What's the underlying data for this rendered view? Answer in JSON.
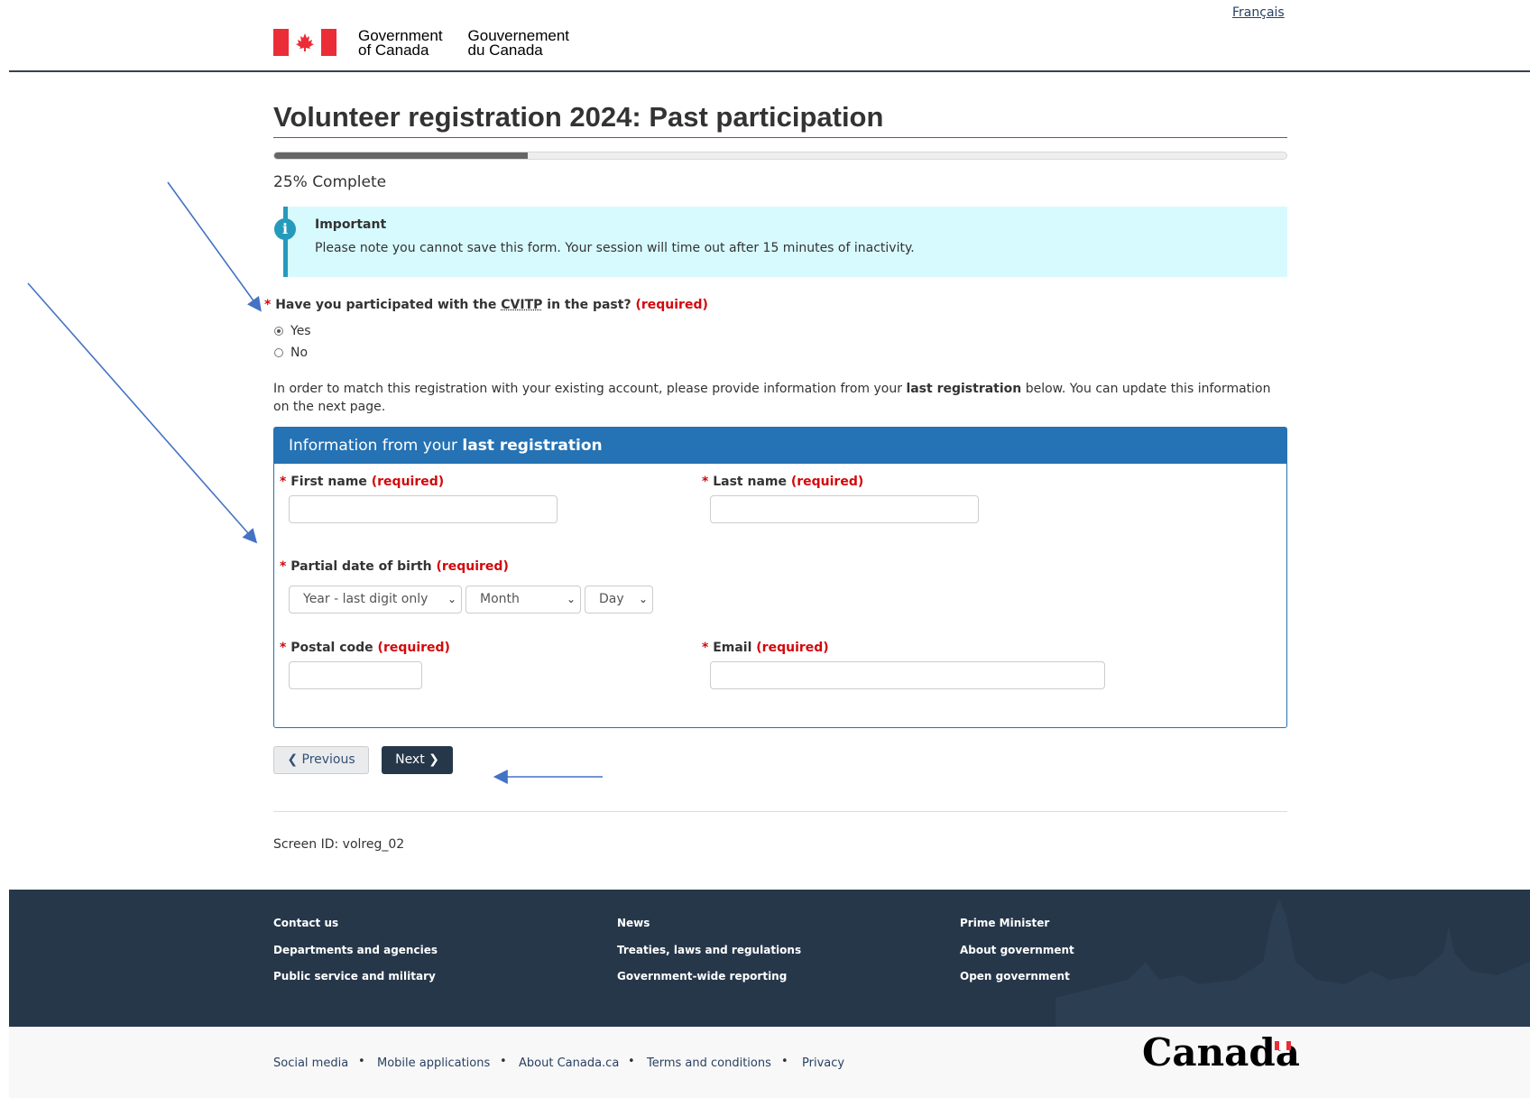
{
  "header": {
    "language_link": "Français",
    "signature_en_line1": "Government",
    "signature_en_line2": "of Canada",
    "signature_fr_line1": "Gouvernement",
    "signature_fr_line2": "du Canada"
  },
  "page": {
    "title": "Volunteer registration 2024: Past participation",
    "progress_percent": 25,
    "progress_label": "25% Complete"
  },
  "alert": {
    "title": "Important",
    "text": "Please note you cannot save this form. Your session will time out after 15 minutes of inactivity."
  },
  "question": {
    "star": "*",
    "text_before": "Have you participated with the ",
    "abbr": "CVITP",
    "text_after": " in the past?",
    "required": "(required)",
    "options": [
      {
        "label": "Yes",
        "checked": true
      },
      {
        "label": "No",
        "checked": false
      }
    ]
  },
  "info": {
    "text_before": "In order to match this registration with your existing account, please provide information from your ",
    "bold": "last registration",
    "text_after": " below. You can update this information on the next page."
  },
  "panel": {
    "heading_before": "Information from your ",
    "heading_bold": "last registration",
    "required_marker": "(required)",
    "star": "*",
    "first_name_label": "First name",
    "last_name_label": "Last name",
    "dob_label": "Partial date of birth",
    "postal_label": "Postal code",
    "email_label": "Email",
    "first_name_value": "",
    "last_name_value": "",
    "postal_value": "",
    "email_value": "",
    "year_select": "Year - last digit only",
    "month_select": "Month",
    "day_select": "Day"
  },
  "buttons": {
    "previous": "Previous",
    "next": "Next"
  },
  "screen_id": "Screen ID: volreg_02",
  "footer": {
    "col1": [
      "Contact us",
      "Departments and agencies",
      "Public service and military"
    ],
    "col2": [
      "News",
      "Treaties, laws and regulations",
      "Government-wide reporting"
    ],
    "col3": [
      "Prime Minister",
      "About government",
      "Open government"
    ],
    "sub_links": [
      "Social media",
      "Mobile applications",
      "About Canada.ca",
      "Terms and conditions",
      "Privacy"
    ],
    "separator": "•",
    "wordmark": "Canada"
  },
  "colors": {
    "flag_red": "#eb2d37",
    "required_red": "#d3080c",
    "panel_blue": "#2572b4",
    "alert_bg": "#d7faff",
    "footer_dark": "#26374a",
    "annotation_arrow": "#4472c4"
  },
  "icons": {
    "alert": "info-icon",
    "previous": "chevron-left-icon",
    "next": "chevron-right-icon",
    "select": "chevron-down-icon"
  }
}
